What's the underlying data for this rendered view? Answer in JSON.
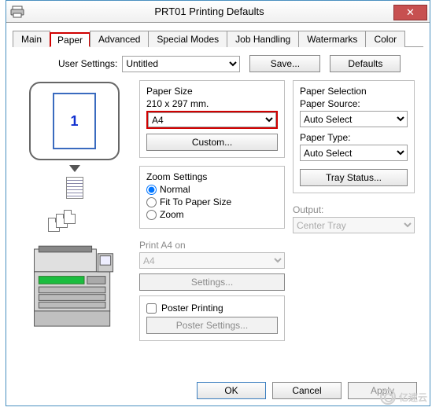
{
  "window": {
    "title": "PRT01 Printing Defaults",
    "close": "✕"
  },
  "tabs": [
    {
      "label": "Main"
    },
    {
      "label": "Paper"
    },
    {
      "label": "Advanced"
    },
    {
      "label": "Special Modes"
    },
    {
      "label": "Job Handling"
    },
    {
      "label": "Watermarks"
    },
    {
      "label": "Color"
    }
  ],
  "user_settings": {
    "label": "User Settings:",
    "value": "Untitled",
    "save": "Save...",
    "defaults": "Defaults"
  },
  "preview": {
    "page_number": "1"
  },
  "paper_size": {
    "group": "Paper Size",
    "dimensions": "210 x 297 mm.",
    "value": "A4",
    "custom": "Custom..."
  },
  "zoom": {
    "group": "Zoom Settings",
    "normal": "Normal",
    "fit": "Fit To Paper Size",
    "zoom": "Zoom"
  },
  "print_on": {
    "label": "Print A4 on",
    "value": "A4",
    "settings": "Settings..."
  },
  "poster": {
    "label": "Poster Printing",
    "settings": "Poster Settings..."
  },
  "paper_sel": {
    "group": "Paper Selection",
    "source_label": "Paper Source:",
    "source_value": "Auto Select",
    "type_label": "Paper Type:",
    "type_value": "Auto Select",
    "tray_status": "Tray Status..."
  },
  "output": {
    "label": "Output:",
    "value": "Center Tray"
  },
  "footer": {
    "ok": "OK",
    "cancel": "Cancel",
    "apply": "Apply"
  },
  "watermark": "亿速云"
}
